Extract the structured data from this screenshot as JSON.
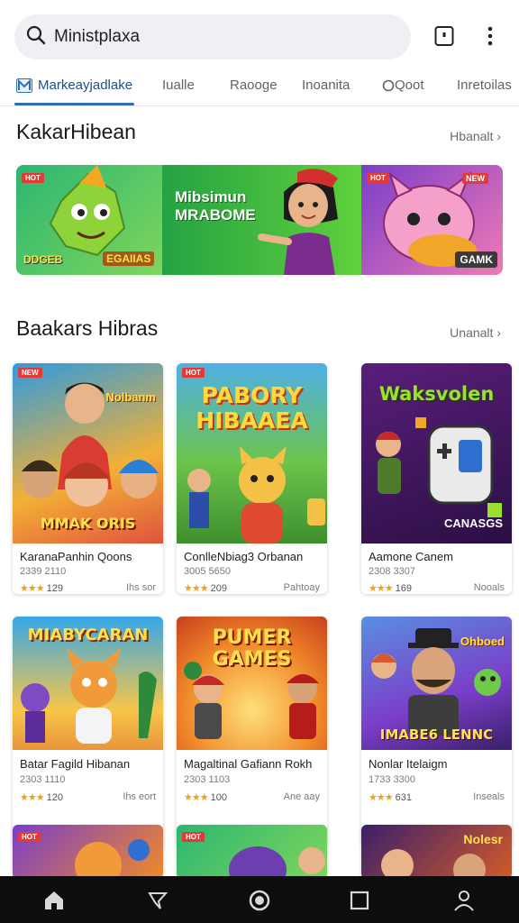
{
  "search": {
    "value": "Ministplaxa"
  },
  "tabs": [
    {
      "label": "Markeayjadlake",
      "active": true
    },
    {
      "label": "Iualle"
    },
    {
      "label": "Raooge"
    },
    {
      "label": "Inoanita"
    },
    {
      "label": "Qoot"
    },
    {
      "label": "Inretoilas"
    }
  ],
  "featured": {
    "title": "KakarHibean",
    "more": "Hbanalt",
    "banner": {
      "left_text_1": "DDGEB",
      "left_text_2": "EGAIIAS",
      "center_line_1": "Mibsimun",
      "center_line_2": "MRABOME",
      "right_label": "GAMK",
      "badge": "HOT"
    }
  },
  "popular": {
    "title": "Baakars Hibras",
    "more": "Unanalt",
    "cards": [
      {
        "art_title": "MMAK ORIS",
        "art_top": "Nolbanm",
        "name": "KaranaPanhin Qoons",
        "sub": "2339 2110",
        "rating": "129",
        "tag": "Ihs sor",
        "badge": "NEW"
      },
      {
        "art_title": "PABORY HIBAAEA",
        "art_top": "",
        "name": "ConlleNbiag3 Orbanan",
        "sub": "3005 5650",
        "rating": "209",
        "tag": "Pahtoay",
        "badge": "HOT"
      },
      {
        "art_title": "CANASGS",
        "art_top": "Waksvolen",
        "name": "Aamone Canem",
        "sub": "2308 3307",
        "rating": "169",
        "tag": "Nooals",
        "badge": ""
      },
      {
        "art_title": "MIABYCARAN",
        "art_top": "",
        "name": "Batar Fagild Hibanan",
        "sub": "2303 1110",
        "rating": "120",
        "tag": "Ihs eort",
        "badge": ""
      },
      {
        "art_title": "PUMER GAMES",
        "art_top": "",
        "name": "Magaltinal Gafiann Rokh",
        "sub": "2303 1103",
        "rating": "100",
        "tag": "Ane aay",
        "badge": ""
      },
      {
        "art_title": "IMABE6 LENNC",
        "art_top": "Ohboed",
        "name": "Nonlar Itelaigm",
        "sub": "1733 3300",
        "rating": "631",
        "tag": "Inseals",
        "badge": ""
      }
    ]
  },
  "bottom_nav": [
    "home-icon",
    "chat-icon",
    "circle-icon",
    "square-icon",
    "profile-icon"
  ],
  "colors": {
    "accent": "#2c6db5",
    "star": "#e8a21b",
    "nav_bg": "#0d0d0d"
  }
}
